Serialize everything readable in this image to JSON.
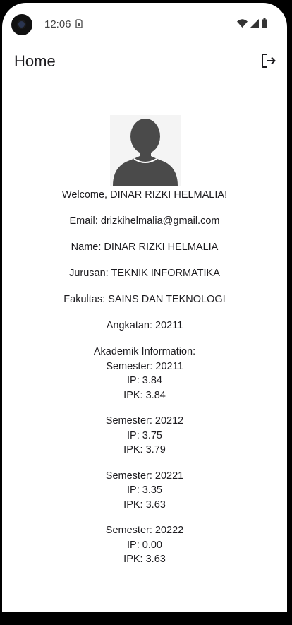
{
  "status_bar": {
    "time": "12:06"
  },
  "app_bar": {
    "title": "Home"
  },
  "profile": {
    "welcome": "Welcome, DINAR RIZKI HELMALIA!",
    "email": "Email: drizkihelmalia@gmail.com",
    "name": "Name: DINAR RIZKI HELMALIA",
    "jurusan": "Jurusan: TEKNIK INFORMATIKA",
    "fakultas": "Fakultas: SAINS DAN TEKNOLOGI",
    "angkatan": "Angkatan: 20211"
  },
  "akademik": {
    "heading": "Akademik Information:",
    "semesters": [
      {
        "semester": "Semester: 20211",
        "ip": "IP: 3.84",
        "ipk": "IPK: 3.84"
      },
      {
        "semester": "Semester: 20212",
        "ip": "IP: 3.75",
        "ipk": "IPK: 3.79"
      },
      {
        "semester": "Semester: 20221",
        "ip": "IP: 3.35",
        "ipk": "IPK: 3.63"
      },
      {
        "semester": "Semester: 20222",
        "ip": "IP: 0.00",
        "ipk": "IPK: 3.63"
      }
    ]
  }
}
